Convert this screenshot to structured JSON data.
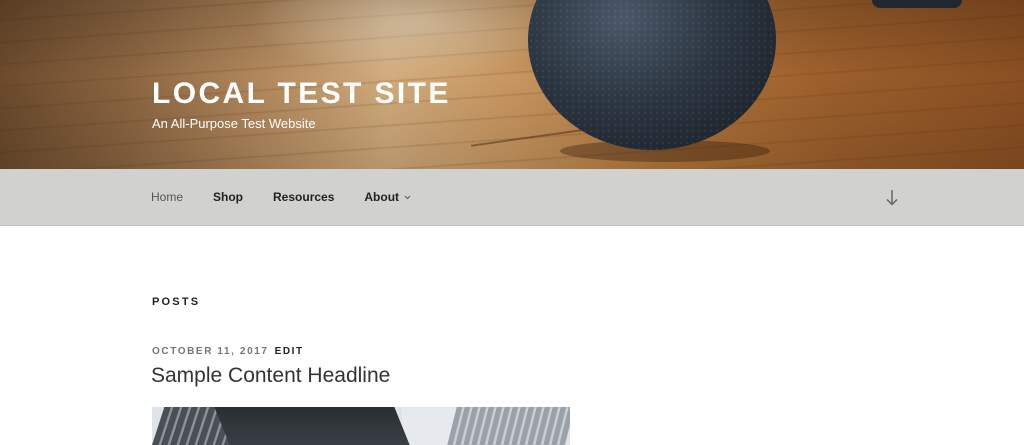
{
  "header": {
    "site_title": "LOCAL TEST SITE",
    "site_description": "An All-Purpose Test Website"
  },
  "nav": {
    "items": [
      {
        "label": "Home",
        "current": true
      },
      {
        "label": "Shop"
      },
      {
        "label": "Resources"
      },
      {
        "label": "About",
        "has_submenu": true
      }
    ],
    "scroll_icon": "arrow-down-icon"
  },
  "content": {
    "page_title": "POSTS",
    "post": {
      "date": "OCTOBER 11, 2017",
      "edit_label": "EDIT",
      "title": "Sample Content Headline"
    }
  },
  "colors": {
    "nav_background": "#d1d2cf",
    "text_dark": "#222222",
    "meta_gray": "#767676"
  }
}
